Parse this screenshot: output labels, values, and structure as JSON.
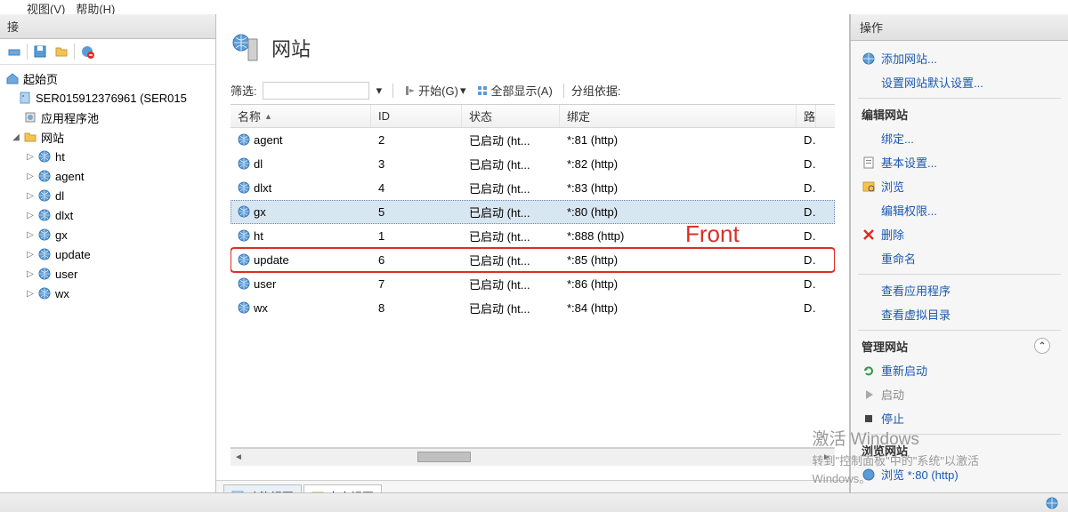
{
  "menu": {
    "view": "视图(V)",
    "help": "帮助(H)"
  },
  "leftHeader": "接",
  "tree": {
    "startPage": "起始页",
    "server": "SER015912376961 (SER015",
    "appPool": "应用程序池",
    "sites": "网站",
    "items": [
      "ht",
      "agent",
      "dl",
      "dlxt",
      "gx",
      "update",
      "user",
      "wx"
    ]
  },
  "main": {
    "title": "网站",
    "filterLabel": "筛选:",
    "startLabel": "开始(G)",
    "showAllLabel": "全部显示(A)",
    "groupLabel": "分组依据:",
    "columns": {
      "name": "名称",
      "id": "ID",
      "state": "状态",
      "binding": "绑定",
      "path": "路"
    },
    "rows": [
      {
        "name": "agent",
        "id": "2",
        "state": "已启动 (ht...",
        "binding": "*:81 (http)",
        "path": "D:"
      },
      {
        "name": "dl",
        "id": "3",
        "state": "已启动 (ht...",
        "binding": "*:82 (http)",
        "path": "D:"
      },
      {
        "name": "dlxt",
        "id": "4",
        "state": "已启动 (ht...",
        "binding": "*:83 (http)",
        "path": "D:"
      },
      {
        "name": "gx",
        "id": "5",
        "state": "已启动 (ht...",
        "binding": "*:80 (http)",
        "path": "D:",
        "selected": true
      },
      {
        "name": "ht",
        "id": "1",
        "state": "已启动 (ht...",
        "binding": "*:888 (http)",
        "path": "D:"
      },
      {
        "name": "update",
        "id": "6",
        "state": "已启动 (ht...",
        "binding": "*:85 (http)",
        "path": "D:",
        "highlighted": true
      },
      {
        "name": "user",
        "id": "7",
        "state": "已启动 (ht...",
        "binding": "*:86 (http)",
        "path": "D:"
      },
      {
        "name": "wx",
        "id": "8",
        "state": "已启动 (ht...",
        "binding": "*:84 (http)",
        "path": "D:"
      }
    ],
    "featureView": "功能视图",
    "contentView": "内容视图",
    "frontLabel": "Front"
  },
  "actions": {
    "header": "操作",
    "addSite": "添加网站...",
    "setDefault": "设置网站默认设置...",
    "editSection": "编辑网站",
    "bindings": "绑定...",
    "basicSettings": "基本设置...",
    "browse": "浏览",
    "editPerm": "编辑权限...",
    "delete": "删除",
    "rename": "重命名",
    "viewApps": "查看应用程序",
    "viewVdir": "查看虚拟目录",
    "manageSection": "管理网站",
    "restart": "重新启动",
    "start": "启动",
    "stop": "停止",
    "browseSection": "浏览网站",
    "browse80": "浏览 *:80 (http)"
  },
  "watermark": {
    "line1": "激活 Windows",
    "line2": "转到\"控制面板\"中的\"系统\"以激活",
    "line3": "Windows。"
  }
}
